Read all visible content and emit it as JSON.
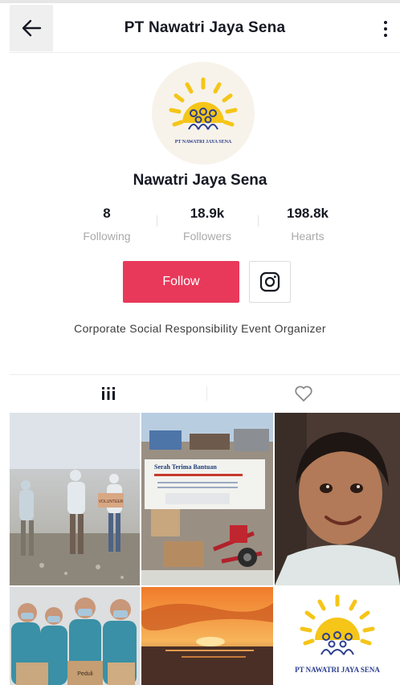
{
  "header": {
    "title": "PT Nawatri Jaya Sena"
  },
  "icons": {
    "back": "arrow-left-icon",
    "more": "more-vertical-icon",
    "instagram": "instagram-icon",
    "grid": "grid-icon",
    "liked": "heart-icon"
  },
  "profile": {
    "logo_caption": "PT NAWATRI JAYA SENA",
    "display_name": "Nawatri Jaya Sena",
    "bio": "Corporate Social Responsibility Event Organizer"
  },
  "stats": [
    {
      "value": "8",
      "label": "Following"
    },
    {
      "value": "18.9k",
      "label": "Followers"
    },
    {
      "value": "198.8k",
      "label": "Hearts"
    }
  ],
  "actions": {
    "follow_label": "Follow"
  },
  "grid": {
    "banner_title": "Serah Terima Bantuan",
    "volunteer_sign": "VOLUNTEER",
    "box_text": "Peduli",
    "logo_caption": "PT NAWATRI JAYA SENA"
  },
  "colors": {
    "accent": "#e8395a",
    "sun": "#f5c518",
    "logo_text": "#2c3e8f",
    "muted": "#a9a9a9"
  }
}
